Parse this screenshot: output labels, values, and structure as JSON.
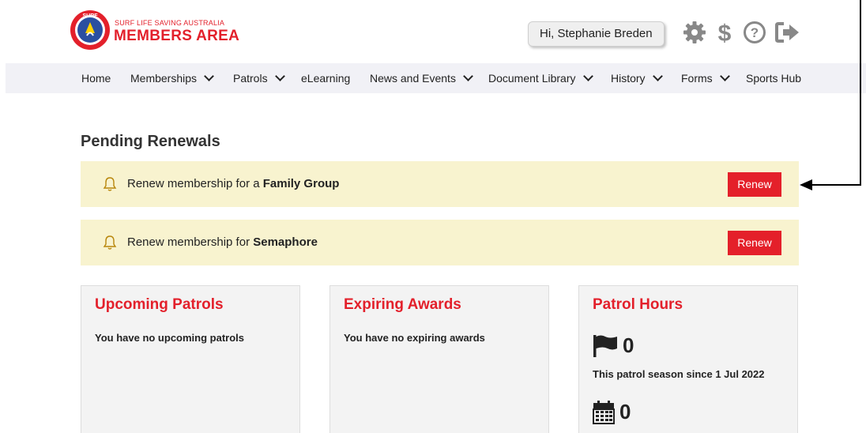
{
  "header": {
    "logo_subtitle": "SURF LIFE SAVING AUSTRALIA",
    "logo_title": "MEMBERS AREA",
    "greeting": "Hi, Stephanie Breden",
    "icons": [
      "gear-icon",
      "dollar-icon",
      "help-icon",
      "logout-icon"
    ]
  },
  "nav": {
    "items": [
      {
        "label": "Home",
        "dropdown": false
      },
      {
        "label": "Memberships",
        "dropdown": true
      },
      {
        "label": "Patrols",
        "dropdown": true
      },
      {
        "label": "eLearning",
        "dropdown": false
      },
      {
        "label": "News and Events",
        "dropdown": true
      },
      {
        "label": "Document Library",
        "dropdown": true
      },
      {
        "label": "History",
        "dropdown": true
      },
      {
        "label": "Forms",
        "dropdown": true
      },
      {
        "label": "Sports Hub",
        "dropdown": false
      }
    ]
  },
  "main": {
    "title": "Pending Renewals",
    "renewals": [
      {
        "prefix": "Renew membership for a ",
        "name": "Family Group",
        "button": "Renew"
      },
      {
        "prefix": "Renew membership for ",
        "name": "Semaphore",
        "button": "Renew"
      }
    ],
    "cards": {
      "upcoming": {
        "title": "Upcoming Patrols",
        "text": "You have no upcoming patrols"
      },
      "expiring": {
        "title": "Expiring Awards",
        "text": "You have no expiring awards"
      },
      "hours": {
        "title": "Patrol Hours",
        "season_value": "0",
        "season_label": "This patrol season since 1 Jul 2022",
        "calendar_value": "0"
      }
    }
  },
  "colors": {
    "brand_red": "#e3202b",
    "alert_bg": "#f8f3cf",
    "nav_bg": "#f1f1f6",
    "card_bg": "#f3f3f3"
  }
}
